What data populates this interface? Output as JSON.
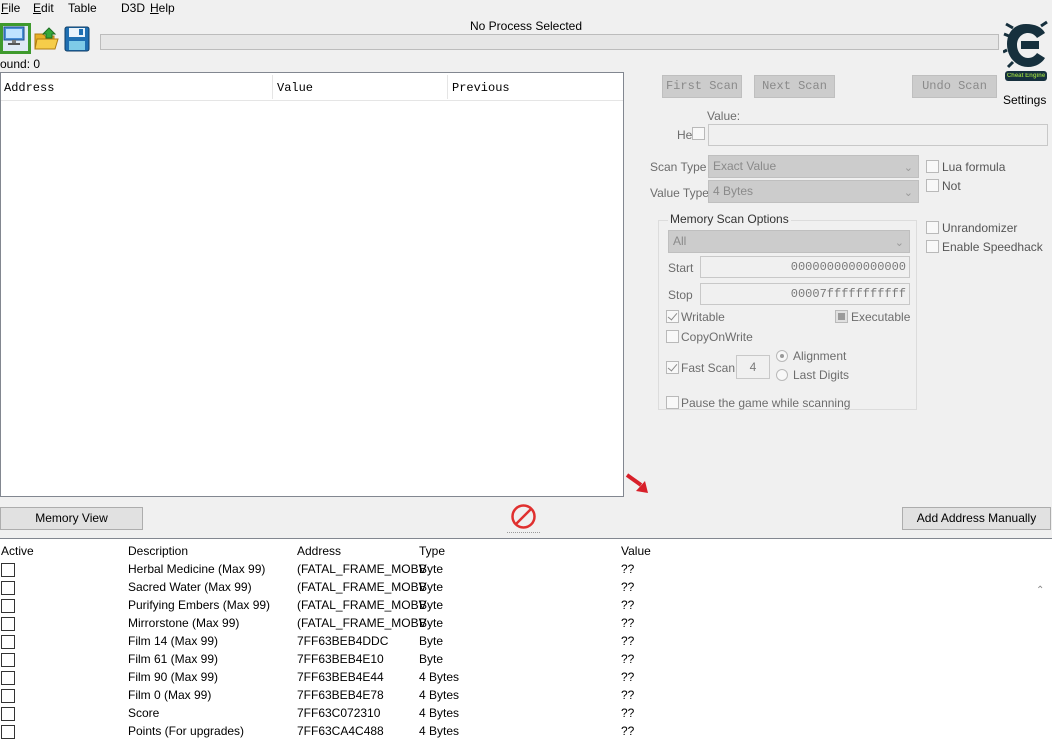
{
  "menu": {
    "items": [
      {
        "label": "File",
        "hotkey": "F",
        "rest": "ile"
      },
      {
        "label": "Edit",
        "hotkey": "E",
        "rest": "dit"
      },
      {
        "label": "Table",
        "hotkey": "",
        "rest": "Table"
      },
      {
        "label": "D3D",
        "hotkey": "",
        "rest": "D3D"
      },
      {
        "label": "Help",
        "hotkey": "H",
        "rest": "elp"
      }
    ]
  },
  "toolbar": {
    "process_title": "No Process Selected",
    "found": "ound: 0",
    "settings_label": "Settings",
    "logo_text": "Cheat Engine"
  },
  "results": {
    "columns": [
      "Address",
      "Value",
      "Previous"
    ]
  },
  "scan": {
    "first_scan": "First Scan",
    "next_scan": "Next Scan",
    "undo_scan": "Undo Scan",
    "value_label": "Value:",
    "hex_label": "Hex",
    "scan_type_label": "Scan Type",
    "scan_type_value": "Exact Value",
    "value_type_label": "Value Type",
    "value_type_value": "4 Bytes",
    "lua_formula": "Lua formula",
    "not_label": "Not",
    "unrandomizer": "Unrandomizer",
    "enable_speedhack": "Enable Speedhack"
  },
  "memory_scan_options": {
    "title": "Memory Scan Options",
    "region": "All",
    "start_label": "Start",
    "start_value": "0000000000000000",
    "stop_label": "Stop",
    "stop_value": "00007fffffffffff",
    "writable": "Writable",
    "executable": "Executable",
    "copy_on_write": "CopyOnWrite",
    "fast_scan": "Fast Scan",
    "fast_scan_value": "4",
    "alignment": "Alignment",
    "last_digits": "Last Digits",
    "pause_game": "Pause the game while scanning"
  },
  "bottom_bar": {
    "memory_view": "Memory View",
    "add_address": "Add Address Manually"
  },
  "address_table": {
    "columns": [
      "Active",
      "Description",
      "Address",
      "Type",
      "Value"
    ],
    "rows": [
      {
        "description": "Herbal Medicine (Max 99)",
        "address": "(FATAL_FRAME_MOBV",
        "type": "Byte",
        "value": "??"
      },
      {
        "description": "Sacred Water (Max 99)",
        "address": "(FATAL_FRAME_MOBV",
        "type": "Byte",
        "value": "??"
      },
      {
        "description": "Purifying Embers (Max 99)",
        "address": "(FATAL_FRAME_MOBV",
        "type": "Byte",
        "value": "??"
      },
      {
        "description": "Mirrorstone (Max 99)",
        "address": "(FATAL_FRAME_MOBV",
        "type": "Byte",
        "value": "??"
      },
      {
        "description": "Film 14 (Max 99)",
        "address": "7FF63BEB4DDC",
        "type": "Byte",
        "value": "??"
      },
      {
        "description": "Film 61 (Max 99)",
        "address": "7FF63BEB4E10",
        "type": "Byte",
        "value": "??"
      },
      {
        "description": "Film 90 (Max 99)",
        "address": "7FF63BEB4E44",
        "type": "4 Bytes",
        "value": "??"
      },
      {
        "description": "Film 0 (Max 99)",
        "address": "7FF63BEB4E78",
        "type": "4 Bytes",
        "value": "??"
      },
      {
        "description": "Score",
        "address": "7FF63C072310",
        "type": "4 Bytes",
        "value": "??"
      },
      {
        "description": "Points (For upgrades)",
        "address": "7FF63CA4C488",
        "type": "4 Bytes",
        "value": "??"
      }
    ]
  }
}
